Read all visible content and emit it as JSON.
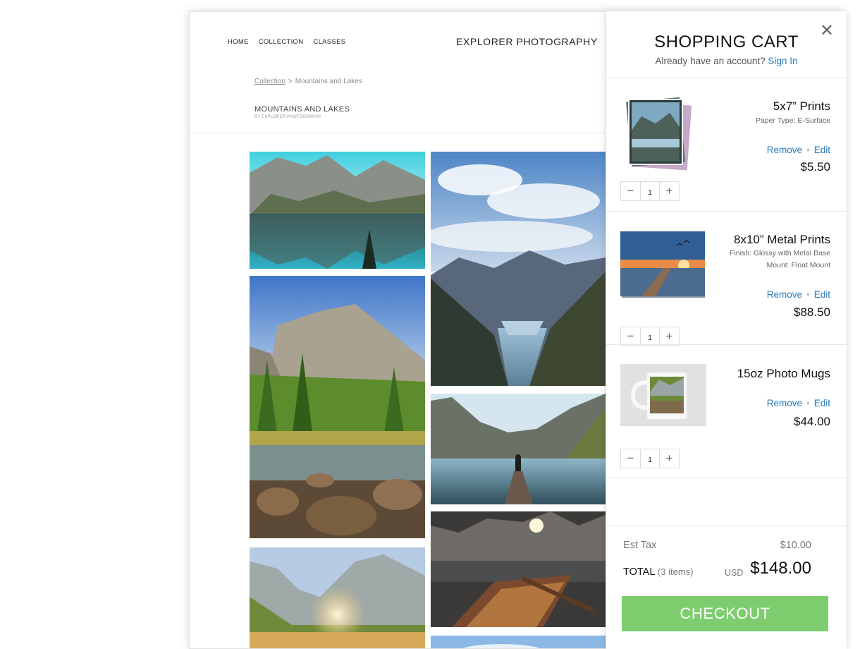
{
  "site": {
    "nav": [
      "HOME",
      "COLLECTION",
      "CLASSES"
    ],
    "brand": "EXPLORER PHOTOGRAPHY",
    "breadcrumb": {
      "link": "Collection",
      "separator": ">",
      "current": "Mountains and Lakes"
    },
    "gallery_title": "MOUNTAINS AND LAKES",
    "gallery_subtitle": "BY EXPLORER PHOTOGRAPHY"
  },
  "cart": {
    "title": "SHOPPING CART",
    "close_icon": "close-icon",
    "account_prompt": "Already have an account?",
    "sign_in": "Sign In",
    "remove_label": "Remove",
    "edit_label": "Edit",
    "items": [
      {
        "name": "5x7” Prints",
        "details": [
          "Paper Type: E-Surface"
        ],
        "price": "$5.50",
        "qty": "1"
      },
      {
        "name": "8x10” Metal Prints",
        "details": [
          "Finish: Glossy with Metal Base",
          "Mount: Float Mount"
        ],
        "price": "$88.50",
        "qty": "1"
      },
      {
        "name": "15oz Photo Mugs",
        "details": [],
        "price": "$44.00",
        "qty": "1"
      }
    ],
    "tax_label": "Est Tax",
    "tax_value": "$10.00",
    "total_label": "TOTAL",
    "total_count": "(3 items)",
    "currency": "USD",
    "total_value": "$148.00",
    "checkout_label": "CHECKOUT"
  },
  "colors": {
    "link": "#2a7ab8",
    "checkout": "#7dcd6f"
  }
}
